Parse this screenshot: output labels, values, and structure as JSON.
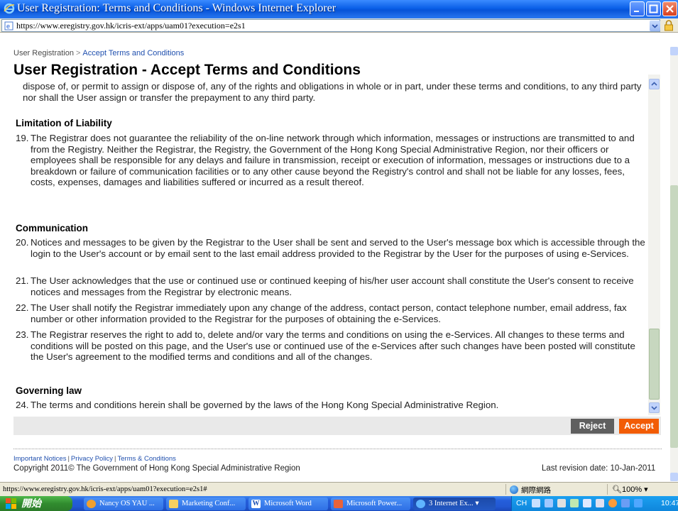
{
  "window": {
    "title": "User Registration: Terms and Conditions - Windows Internet Explorer",
    "url": "https://www.eregistry.gov.hk/icris-ext/apps/uam01?execution=e2s1"
  },
  "breadcrumb": {
    "root": "User Registration",
    "separator": ">",
    "current": "Accept Terms and Conditions"
  },
  "page_title": "User Registration - Accept Terms and Conditions",
  "terms": {
    "cut_text": "dispose of, or permit to assign or dispose of, any of the rights and obligations in whole or in part, under these terms and conditions, to any third party nor shall the User assign or transfer the prepayment to any third party.",
    "sections": [
      {
        "heading": "Limitation of Liability",
        "clauses": [
          {
            "num": "19.",
            "text": "The Registrar does not guarantee the reliability of the on-line network through which information, messages or instructions are transmitted to and from the Registry. Neither the Registrar, the Registry, the Government of the Hong Kong Special Administrative Region, nor their officers or employees shall be responsible for any delays and failure in transmission, receipt or execution of information, messages or instructions due to a breakdown or failure of communication facilities or to any other cause beyond the Registry's control and shall not be liable for any losses, fees, costs, expenses, damages and liabilities suffered or incurred as a result thereof."
          }
        ]
      },
      {
        "heading": "Communication",
        "clauses": [
          {
            "num": "20.",
            "text": "Notices and messages to be given by the Registrar to the User shall be sent and served to the User's message box which is accessible through the login to the User's account or by email sent to the last email address provided to the Registrar by the User for the purposes of using e-Services."
          },
          {
            "num": "21.",
            "text": "The User acknowledges that the use or continued use or continued keeping of his/her user account shall constitute the User's consent to receive notices and messages from the Registrar by electronic means."
          },
          {
            "num": "22.",
            "text": "The User shall notify the Registrar immediately upon any change of the address, contact person, contact telephone number, email address, fax number or other information provided to the Registrar for the purposes of obtaining the e-Services."
          },
          {
            "num": "23.",
            "text": "The Registrar reserves the right to add to, delete and/or vary the terms and conditions on using the e-Services. All changes to these terms and conditions will be posted on this page, and the User's use or continued use of the e-Services after such changes have been posted will constitute the User's agreement to the modified terms and conditions and all of the changes."
          }
        ]
      },
      {
        "heading": "Governing law",
        "clauses": [
          {
            "num": "24.",
            "text": "The terms and conditions herein shall be governed by the laws of the Hong Kong Special Administrative Region."
          }
        ]
      }
    ]
  },
  "actions": {
    "reject": "Reject",
    "accept": "Accept"
  },
  "footer": {
    "links": [
      "Important Notices",
      "Privacy Policy",
      "Terms & Conditions"
    ],
    "link_separator": "|",
    "copyright": "Copyright 2011© The Government of Hong Kong Special Administrative Region",
    "revision": "Last revision date: 10-Jan-2011"
  },
  "statusbar": {
    "url": "https://www.eregistry.gov.hk/icris-ext/apps/uam01?execution=e2s1#",
    "zone": "網際網路",
    "zoom": "100%"
  },
  "taskbar": {
    "start": "開始",
    "tasks": [
      "Nancy OS YAU ...",
      "Marketing Conf...",
      "Microsoft Word",
      "Microsoft Power...",
      "3 Internet Ex..."
    ],
    "lang": "CH",
    "clock": "10:47"
  },
  "colors": {
    "accent_orange": "#f25c05",
    "reject_gray": "#5f5f5f",
    "link_blue": "#1f4fae"
  }
}
